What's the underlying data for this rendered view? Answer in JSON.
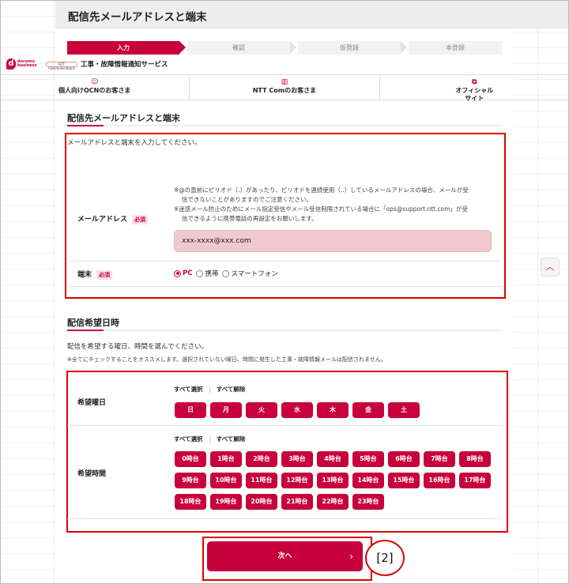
{
  "title": "配信先メールアドレスと端末",
  "steps": [
    "入力",
    "確認",
    "仮登録",
    "本登録"
  ],
  "brand": {
    "docomo": "docomo business",
    "ntt": "NTT Communications",
    "service": "工事・故障情報通知サービス"
  },
  "nav": [
    {
      "icon": "person-icon",
      "label": "個人向けOCNのお客さま"
    },
    {
      "icon": "building-icon",
      "label": "NTT Comのお客さま"
    },
    {
      "icon": "external-link-icon",
      "label_line1": "オフィシャル",
      "label_line2": "サイト"
    }
  ],
  "section1": {
    "heading": "配信先メールアドレスと端末",
    "intro": "メールアドレスと端末を入力してください。",
    "email_label": "メールアドレス",
    "required": "必須",
    "note1": "※@の直前にピリオド（.）があったり、ピリオドを連続使用（..）しているメールアドレスの場合、メールが受",
    "note1b": "信できないことがありますのでご注意ください。",
    "note2": "※迷惑メール防止のためにメール指定受信やメール受信制限されている場合に「ops@support.ntt.com」が受",
    "note2b": "信できるように携帯電話の再設定をお願いします。",
    "email_value": "xxx-xxxx@xxx.com",
    "device_label": "端末",
    "device_options": [
      "PC",
      "携帯",
      "スマートフォン"
    ],
    "device_selected": "PC"
  },
  "section2": {
    "heading": "配信希望日時",
    "intro": "配信を希望する曜日、時間を選んでください。",
    "note": "※全てにチェックすることをオススメします。選択されていない曜日、時間に発生した工事・故障情報メールは配信されません。",
    "day_label": "希望曜日",
    "time_label": "希望時間",
    "select_all": "すべて選択",
    "deselect_all": "すべて解除",
    "days": [
      "日",
      "月",
      "火",
      "水",
      "木",
      "金",
      "土"
    ],
    "hours": [
      "0時台",
      "1時台",
      "2時台",
      "3時台",
      "4時台",
      "5時台",
      "6時台",
      "7時台",
      "8時台",
      "9時台",
      "10時台",
      "11時台",
      "12時台",
      "13時台",
      "14時台",
      "15時台",
      "16時台",
      "17時台",
      "18時台",
      "19時台",
      "20時台",
      "21時台",
      "22時台",
      "23時台"
    ]
  },
  "next_button": "次へ",
  "annotation": "[2]",
  "colors": {
    "accent": "#c8003c",
    "highlight_box": "#dd0000",
    "input_bg": "#f0c9cf"
  }
}
